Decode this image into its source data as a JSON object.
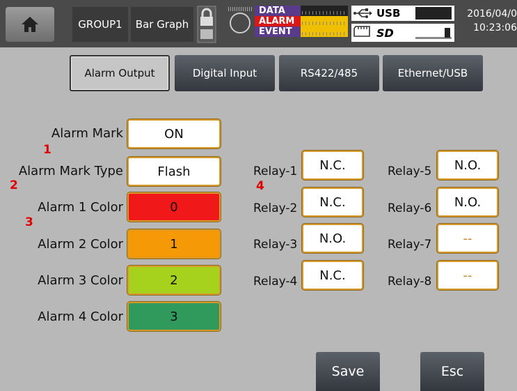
{
  "status_bar": {
    "group": "GROUP1",
    "view": "Bar Graph",
    "data_label": "DATA",
    "alarm_label": "ALARM",
    "event_label": "EVENT",
    "usb_label": "USB",
    "sd_label": "SD",
    "date": "2016/04/0",
    "time": "10:23:06"
  },
  "tabs": [
    {
      "label": "Alarm Output",
      "active": true
    },
    {
      "label": "Digital Input",
      "active": false
    },
    {
      "label": "RS422/485",
      "active": false
    },
    {
      "label": "Ethernet/USB",
      "active": false
    }
  ],
  "settings": {
    "alarm_mark": {
      "label": "Alarm Mark",
      "value": "ON",
      "marker": "1"
    },
    "alarm_mark_type": {
      "label": "Alarm Mark Type",
      "value": "Flash",
      "marker": "2"
    },
    "alarm1_color": {
      "label": "Alarm 1 Color",
      "value": "0",
      "color": "#f01818",
      "marker": "3"
    },
    "alarm2_color": {
      "label": "Alarm 2 Color",
      "value": "1",
      "color": "#f59a06"
    },
    "alarm3_color": {
      "label": "Alarm 3 Color",
      "value": "2",
      "color": "#a6d21e"
    },
    "alarm4_color": {
      "label": "Alarm 4 Color",
      "value": "3",
      "color": "#2f9a5c"
    }
  },
  "relays_marker": "4",
  "relays": [
    {
      "label": "Relay-1",
      "value": "N.C."
    },
    {
      "label": "Relay-2",
      "value": "N.C."
    },
    {
      "label": "Relay-3",
      "value": "N.O."
    },
    {
      "label": "Relay-4",
      "value": "N.C."
    },
    {
      "label": "Relay-5",
      "value": "N.O."
    },
    {
      "label": "Relay-6",
      "value": "N.O."
    },
    {
      "label": "Relay-7",
      "value": "--"
    },
    {
      "label": "Relay-8",
      "value": "--"
    }
  ],
  "buttons": {
    "save": "Save",
    "esc": "Esc"
  },
  "icons": {
    "home": "home-icon",
    "lock": "lock-icon",
    "record": "record-icon",
    "usb": "usb-icon",
    "sd": "sd-card-icon"
  }
}
